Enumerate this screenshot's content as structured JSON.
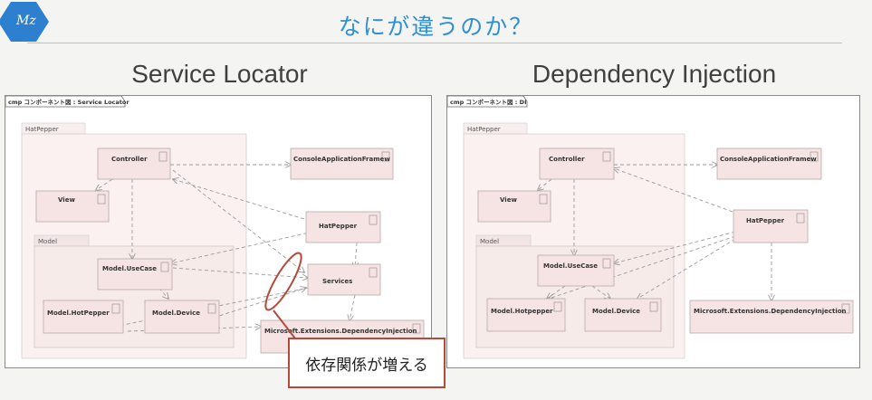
{
  "slide": {
    "logo_text": "Mz",
    "title": "なにが違うのか？"
  },
  "left": {
    "heading": "Service Locator",
    "frame_tab": "cmp コンポーネント図 : Service Locator",
    "packages": {
      "hatpepper": "HatPepper",
      "model": "Model"
    },
    "components": {
      "controller": "Controller",
      "view": "View",
      "model_usecase": "Model.UseCase",
      "model_hotpepper": "Model.HotPepper",
      "model_device": "Model.Device",
      "console": "ConsoleApplicationFramew",
      "hatpepper": "HatPepper",
      "services": "Services",
      "ms_di": "Microsoft.Extensions.DependencyInjection"
    }
  },
  "right": {
    "heading": "Dependency Injection",
    "frame_tab": "cmp コンポーネント図 : DI",
    "packages": {
      "hatpepper": "HatPepper",
      "model": "Model"
    },
    "components": {
      "controller": "Controller",
      "view": "View",
      "model_usecase": "Model.UseCase",
      "model_hotpepper": "Model.Hotpepper",
      "model_device": "Model.Device",
      "console": "ConsoleApplicationFramew",
      "hatpepper": "HatPepper",
      "ms_di": "Microsoft.Extensions.DependencyInjection"
    }
  },
  "callout": {
    "text": "依存関係が増える"
  },
  "colors": {
    "title": "#2f8fd0",
    "callout_border": "#b54a3a",
    "component_fill": "#f6e4e4",
    "logo": "#2d7fcf"
  }
}
